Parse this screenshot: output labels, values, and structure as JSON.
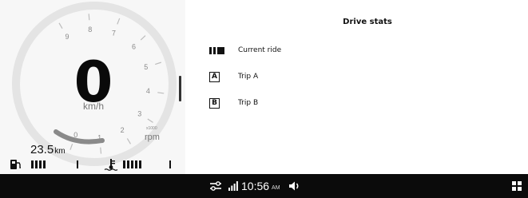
{
  "cluster": {
    "speed": "0",
    "speed_unit": "km/h",
    "rpm_label": "rpm",
    "rpm_scale": "x1000",
    "rpm_ticks": [
      "0",
      "1",
      "2",
      "3",
      "4",
      "5",
      "6",
      "7",
      "8",
      "9"
    ],
    "odometer_value": "23.5",
    "odometer_unit": "km",
    "fuel_level_bars": 4,
    "temp_level_bars": 5,
    "accent_color": "#8a8a8a"
  },
  "drive_stats": {
    "title": "Drive stats",
    "items": [
      {
        "icon": "current-ride-icon",
        "label": "Current ride"
      },
      {
        "icon": "A",
        "label": "Trip A"
      },
      {
        "icon": "B",
        "label": "Trip B"
      }
    ]
  },
  "status_bar": {
    "time": "10:56",
    "ampm": "AM",
    "icons": [
      "tune-icon",
      "signal-icon",
      "volume-icon",
      "apps-grid-icon"
    ]
  }
}
